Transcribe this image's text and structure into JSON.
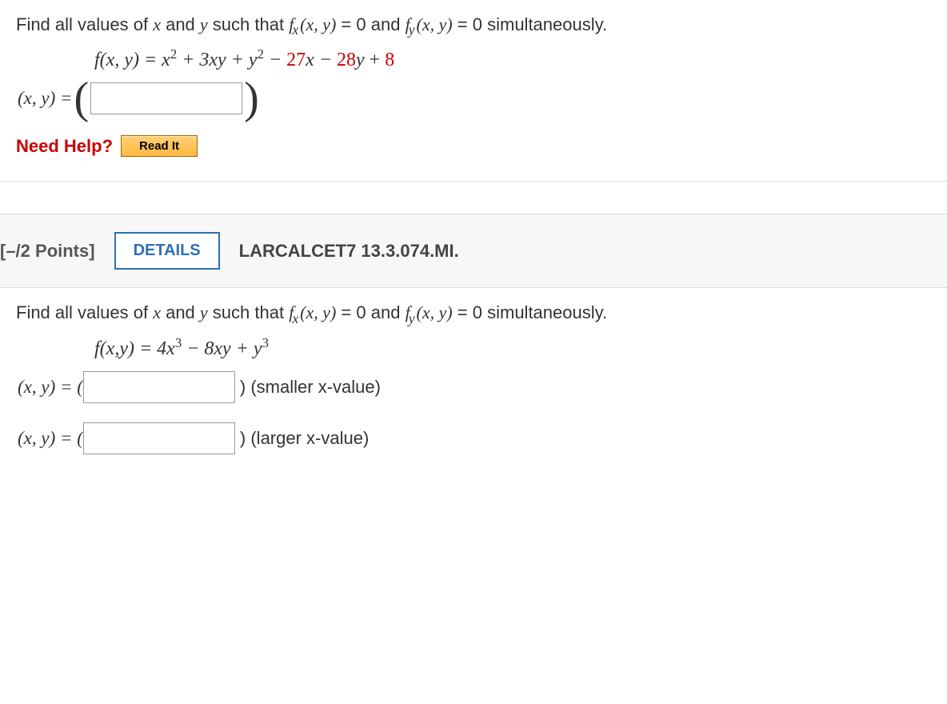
{
  "q1": {
    "prompt_a": "Find all values of ",
    "prompt_b": " and ",
    "prompt_c": " such that ",
    "prompt_d": " = 0 and ",
    "prompt_e": " = 0 simultaneously.",
    "func_lhs": "f(x, y) = ",
    "func_terms": "x",
    "plus_3xy": " + 3xy + ",
    "y_term": "y",
    "sq": "2",
    "minus": " − ",
    "c1": "27",
    "c2": "28",
    "c3": "8",
    "xy_label": "(x, y) = ",
    "need_help": "Need Help?",
    "read_it": "Read It"
  },
  "header2": {
    "points": "[–/2 Points]",
    "details": "DETAILS",
    "ref": "LARCALCET7 13.3.074.MI."
  },
  "q2": {
    "prompt_a": "Find all values of ",
    "prompt_b": " and ",
    "prompt_c": " such that ",
    "prompt_d": " = 0 and ",
    "prompt_e": " = 0 simultaneously.",
    "func_lhs": "f(x,y) = ",
    "term1": "4x",
    "cube": "3",
    "minus8xy": " − 8xy + ",
    "y_term": "y",
    "xy_label1": "(x, y) =  (",
    "xy_label2": "(x, y) =  (",
    "hint1": ")  (smaller x-value)",
    "hint2": ")  (larger x-value)"
  }
}
